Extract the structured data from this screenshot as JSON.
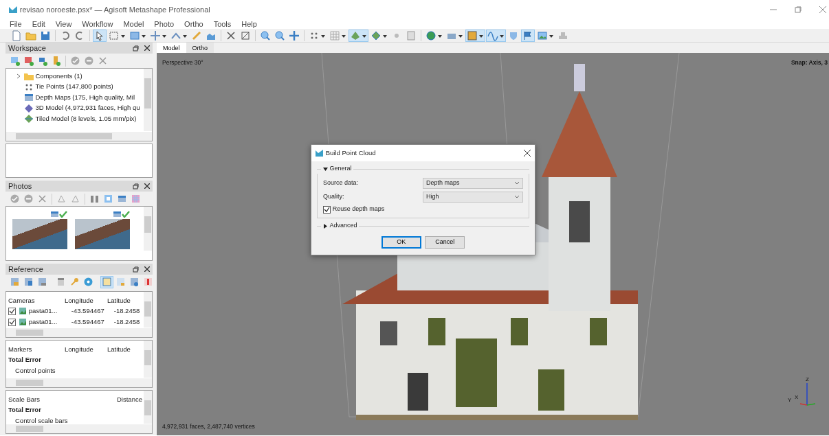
{
  "window": {
    "title": "revisao noroeste.psx* — Agisoft Metashape Professional"
  },
  "menu": [
    "File",
    "Edit",
    "View",
    "Workflow",
    "Model",
    "Photo",
    "Ortho",
    "Tools",
    "Help"
  ],
  "toolbar": [
    {
      "selected": false
    },
    {
      "selected": false
    },
    {
      "selected": false
    },
    {
      "selected": false
    },
    {
      "selected": false
    },
    {
      "selected": true
    },
    {
      "selected": false
    },
    {
      "selected": false
    },
    {
      "selected": false
    },
    {
      "selected": false
    },
    {
      "selected": false
    },
    {
      "selected": false
    },
    {
      "selected": false
    },
    {
      "selected": false
    },
    {
      "selected": false
    },
    {
      "selected": false
    },
    {
      "selected": false
    },
    {
      "selected": false
    },
    {
      "selected": false
    },
    {
      "selected": true
    },
    {
      "selected": false
    },
    {
      "selected": false
    },
    {
      "selected": false
    },
    {
      "selected": false
    },
    {
      "selected": false
    },
    {
      "selected": true
    },
    {
      "selected": true
    },
    {
      "selected": false
    },
    {
      "selected": true
    },
    {
      "selected": false
    },
    {
      "selected": false
    }
  ],
  "workspace": {
    "title": "Workspace",
    "tree": [
      {
        "kind": "group",
        "label": "Components (1)",
        "expanded": false
      },
      {
        "kind": "tiepoints",
        "label": "Tie Points (147,800 points)"
      },
      {
        "kind": "depthmaps",
        "label": "Depth Maps (175, High quality, Mil"
      },
      {
        "kind": "model",
        "label": "3D Model (4,972,931 faces, High qu"
      },
      {
        "kind": "tiled",
        "label": "Tiled Model (8 levels, 1.05 mm/pix)"
      }
    ]
  },
  "photos": {
    "title": "Photos",
    "items": [
      {
        "aligned": true
      },
      {
        "aligned": true
      }
    ]
  },
  "reference": {
    "title": "Reference",
    "toolbar": [
      {
        "selected": false
      },
      {
        "selected": false
      },
      {
        "selected": false
      },
      {
        "selected": false
      },
      {
        "selected": false
      },
      {
        "selected": false
      },
      {
        "selected": true
      },
      {
        "selected": false
      },
      {
        "selected": false
      },
      {
        "selected": false
      }
    ],
    "cameras": {
      "columns": [
        "Cameras",
        "Longitude",
        "Latitude"
      ],
      "rows": [
        {
          "checked": true,
          "name": "pasta01...",
          "longitude": "-43.594467",
          "latitude": "-18.2458"
        },
        {
          "checked": true,
          "name": "pasta01...",
          "longitude": "-43.594467",
          "latitude": "-18.2458"
        }
      ]
    },
    "markers": {
      "columns": [
        "Markers",
        "Longitude",
        "Latitude"
      ],
      "rows": [
        {
          "label": "Total Error",
          "bold": true
        },
        {
          "label": "Control points",
          "bold": false
        }
      ]
    },
    "scale_bars": {
      "columns": [
        "Scale Bars",
        "Distance"
      ],
      "rows": [
        {
          "label": "Total Error",
          "bold": true
        },
        {
          "label": "Control scale bars",
          "bold": false
        }
      ]
    }
  },
  "tabs": [
    {
      "label": "Model",
      "selected": true
    },
    {
      "label": "Ortho",
      "selected": false
    }
  ],
  "viewport": {
    "projection": "Perspective 30°",
    "snap": "Snap: Axis, 3",
    "status": "4,972,931 faces, 2,487,740 vertices",
    "axes": [
      "Z",
      "Y",
      "X"
    ]
  },
  "dialog": {
    "title": "Build Point Cloud",
    "general": {
      "label": "General",
      "expanded": true
    },
    "fields": [
      {
        "label": "Source data:",
        "value": "Depth maps"
      },
      {
        "label": "Quality:",
        "value": "High"
      }
    ],
    "checkbox": {
      "label": "Reuse depth maps",
      "checked": true
    },
    "advanced": {
      "label": "Advanced",
      "expanded": false
    },
    "buttons": [
      {
        "label": "OK",
        "default": true
      },
      {
        "label": "Cancel",
        "default": false
      }
    ]
  }
}
